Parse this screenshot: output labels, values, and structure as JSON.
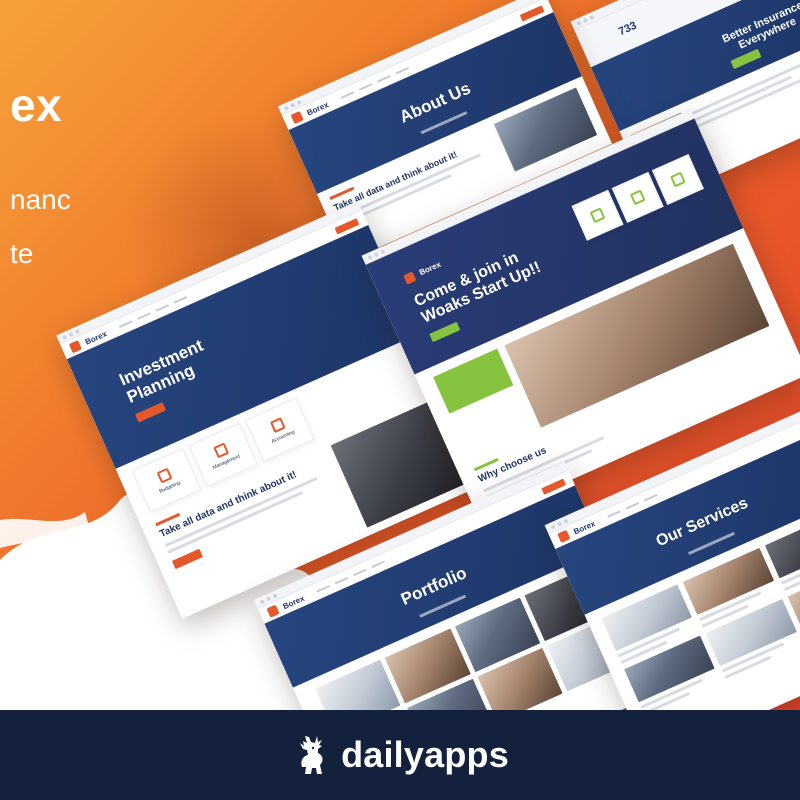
{
  "hero": {
    "brand_partial": "ex",
    "tagline_line1": "nanc",
    "tagline_line2": "te"
  },
  "colors": {
    "orange": "#f07d2c",
    "navy": "#1f3566",
    "green": "#86c43f",
    "footer": "#14213d"
  },
  "mockups": {
    "logo_text": "Borex",
    "investment": {
      "title": "Investment Planning",
      "headline": "Take all data and think about it!"
    },
    "about": {
      "title": "About Us",
      "headline": "Take all data and think about it!"
    },
    "startup": {
      "headline": "Come & join in Woaks Start Up!!",
      "why": "Why choose us"
    },
    "insurance": {
      "stat": "733",
      "headline": "Better Insurance Everywhere"
    },
    "portfolio": {
      "title": "Portfolio"
    },
    "services": {
      "title": "Our Services"
    }
  },
  "footer": {
    "brand": "dailyapps",
    "mascot_icon": "deer-mascot-icon"
  }
}
